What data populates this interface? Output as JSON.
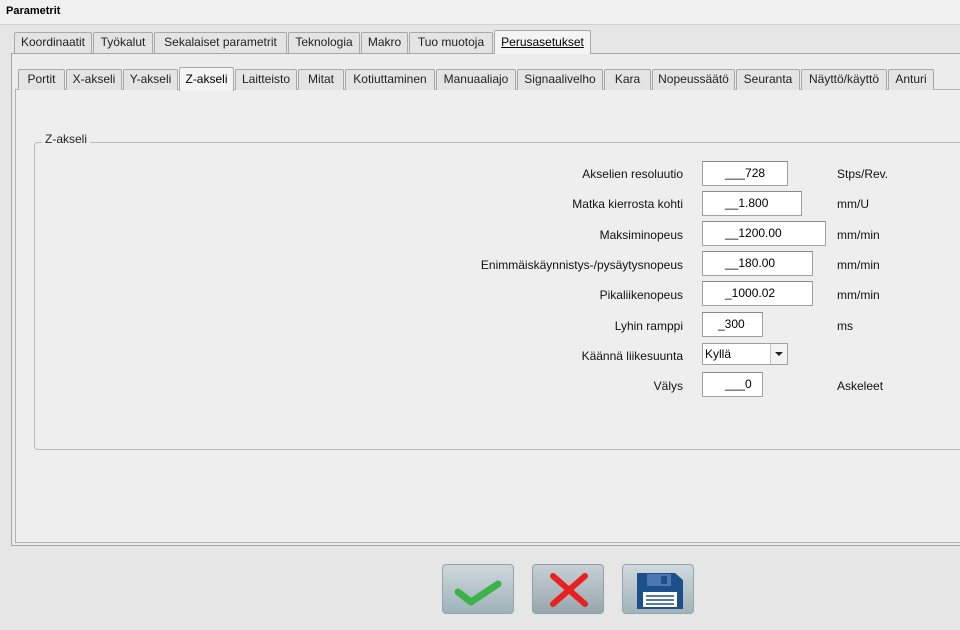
{
  "window": {
    "title": "Parametrit"
  },
  "main_tabs": [
    "Koordinaatit",
    "Työkalut",
    "Sekalaiset parametrit",
    "Teknologia",
    "Makro",
    "Tuo muotoja",
    "Perusasetukset"
  ],
  "main_tab_active": "Perusasetukset",
  "sub_tabs": [
    "Portit",
    "X-akseli",
    "Y-akseli",
    "Z-akseli",
    "Laitteisto",
    "Mitat",
    "Kotiuttaminen",
    "Manuaaliajo",
    "Signaalivelho",
    "Kara",
    "Nopeussäätö",
    "Seuranta",
    "Näyttö/käyttö",
    "Anturi"
  ],
  "sub_tab_active": "Z-akseli",
  "group": {
    "title": "Z-akseli",
    "fields": [
      {
        "label": "Akselien resoluutio",
        "value": "___728",
        "unit": "Stps/Rev."
      },
      {
        "label": "Matka kierrosta kohti",
        "value": "__1.800",
        "unit": "mm/U"
      },
      {
        "label": "Maksiminopeus",
        "value": "__1200.00",
        "unit": "mm/min"
      },
      {
        "label": "Enimmäiskäynnistys-/pysäytysnopeus",
        "value": "__180.00",
        "unit": "mm/min"
      },
      {
        "label": "Pikaliikenopeus",
        "value": "_1000.02",
        "unit": "mm/min"
      },
      {
        "label": "Lyhin ramppi",
        "value": "_300",
        "unit": "ms"
      }
    ],
    "direction": {
      "label": "Käännä liikesuunta",
      "value": "Kyllä"
    },
    "backlash": {
      "label": "Välys",
      "value": "___0",
      "unit": "Askeleet"
    }
  },
  "buttons": {
    "ok_icon": "checkmark-icon",
    "cancel_icon": "close-icon",
    "save_icon": "floppy-disk-icon",
    "ok_color": "#3bb34a",
    "cancel_color": "#e8201f",
    "save_color": "#1d4f8a"
  }
}
